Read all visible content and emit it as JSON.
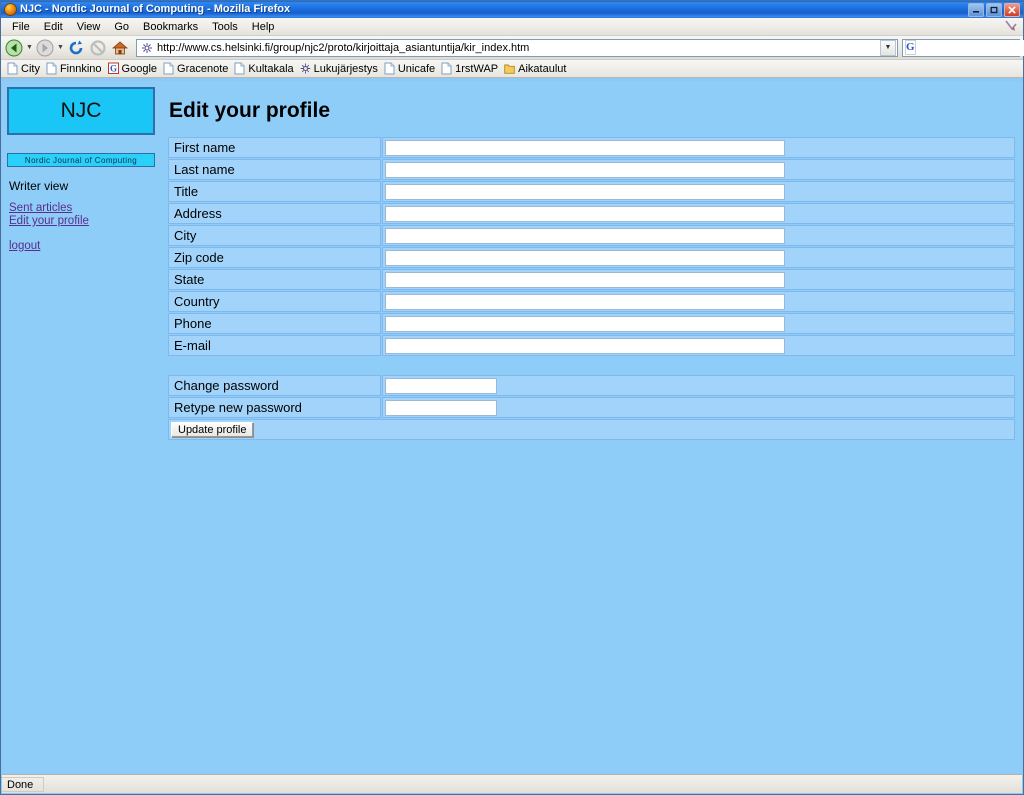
{
  "window": {
    "title": "NJC - Nordic Journal of Computing - Mozilla Firefox",
    "app_icon": "firefox-icon",
    "buttons": {
      "minimize": "minimize-button",
      "restore": "restore-button",
      "close": "close-button"
    }
  },
  "menu": {
    "items": [
      {
        "label": "File"
      },
      {
        "label": "Edit"
      },
      {
        "label": "View"
      },
      {
        "label": "Go"
      },
      {
        "label": "Bookmarks"
      },
      {
        "label": "Tools"
      },
      {
        "label": "Help"
      }
    ]
  },
  "toolbar": {
    "back": "back-icon",
    "forward": "forward-icon",
    "reload": "reload-icon",
    "stop": "stop-icon",
    "home": "home-icon",
    "url": "http://www.cs.helsinki.fi/group/njc2/proto/kirjoittaja_asiantuntija/kir_index.htm",
    "url_placeholder": "",
    "page_icon": "page-favicon",
    "dropdown": "chevron-down-icon",
    "search_engine": "G",
    "search_value": "",
    "search_placeholder": ""
  },
  "bookmarks": [
    {
      "label": "City",
      "icon": "page-icon"
    },
    {
      "label": "Finnkino",
      "icon": "page-icon"
    },
    {
      "label": "Google",
      "icon": "google-icon"
    },
    {
      "label": "Gracenote",
      "icon": "page-icon"
    },
    {
      "label": "Kultakala",
      "icon": "page-icon"
    },
    {
      "label": "Lukujärjestys",
      "icon": "star-icon"
    },
    {
      "label": "Unicafe",
      "icon": "page-icon"
    },
    {
      "label": "1rstWAP",
      "icon": "page-icon"
    },
    {
      "label": "Aikataulut",
      "icon": "folder-icon"
    }
  ],
  "sidebar": {
    "logo": "NJC",
    "banner": "Nordic Journal of Computing",
    "role": "Writer view",
    "links": [
      {
        "label": "Sent articles"
      },
      {
        "label": "Edit your profile"
      },
      {
        "label": "logout"
      }
    ]
  },
  "main": {
    "title": "Edit your profile",
    "fields": [
      {
        "label": "First name",
        "value": ""
      },
      {
        "label": "Last name",
        "value": ""
      },
      {
        "label": "Title",
        "value": ""
      },
      {
        "label": "Address",
        "value": ""
      },
      {
        "label": "City",
        "value": ""
      },
      {
        "label": "Zip code",
        "value": ""
      },
      {
        "label": "State",
        "value": ""
      },
      {
        "label": "Country",
        "value": ""
      },
      {
        "label": "Phone",
        "value": ""
      },
      {
        "label": "E-mail",
        "value": ""
      }
    ],
    "password_fields": [
      {
        "label": "Change password",
        "value": ""
      },
      {
        "label": "Retype new password",
        "value": ""
      }
    ],
    "submit_label": "Update profile"
  },
  "status": {
    "text": "Done"
  },
  "colors": {
    "page_background": "#8ecdf7",
    "row_background": "#a2d4fb",
    "row_border": "#7fb8ec",
    "logo_background": "#19c6f5",
    "logo_border": "#2f6ea8",
    "link": "#5b2d8e",
    "title_bar": "#1b6fdf",
    "close_button": "#cf3b25"
  }
}
